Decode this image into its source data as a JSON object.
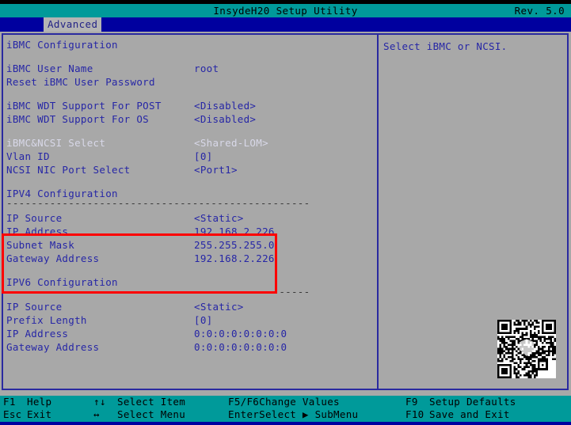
{
  "titlebar": {
    "title": "InsydeH20 Setup Utility",
    "revision": "Rev. 5.0"
  },
  "menubar": {
    "items": [
      {
        "label": "Advanced",
        "selected": true
      }
    ]
  },
  "settings": {
    "rows": [
      {
        "type": "heading",
        "label": "iBMC Configuration",
        "value": ""
      },
      {
        "type": "spacer"
      },
      {
        "type": "item",
        "label": "iBMC User Name",
        "value": "root"
      },
      {
        "type": "item",
        "label": "Reset iBMC User Password",
        "value": ""
      },
      {
        "type": "spacer"
      },
      {
        "type": "item",
        "label": "iBMC WDT Support For POST",
        "value": "<Disabled>"
      },
      {
        "type": "item",
        "label": "iBMC WDT Support For OS",
        "value": "<Disabled>"
      },
      {
        "type": "spacer"
      },
      {
        "type": "item",
        "label": "iBMC&NCSI Select",
        "value": "<Shared-LOM>",
        "selected": true
      },
      {
        "type": "item",
        "label": "Vlan ID",
        "value": "[0]"
      },
      {
        "type": "item",
        "label": "NCSI NIC Port Select",
        "value": "<Port1>"
      },
      {
        "type": "spacer"
      },
      {
        "type": "heading",
        "label": "IPV4 Configuration",
        "value": ""
      },
      {
        "type": "separator",
        "label": "-------------------------------------------------"
      },
      {
        "type": "item",
        "label": "IP Source",
        "value": "<Static>"
      },
      {
        "type": "item",
        "label": "IP Address",
        "value": "192.168.2.226"
      },
      {
        "type": "item",
        "label": "Subnet Mask",
        "value": "255.255.255.0"
      },
      {
        "type": "item",
        "label": "Gateway Address",
        "value": "192.168.2.226"
      },
      {
        "type": "spacer"
      },
      {
        "type": "heading",
        "label": "IPV6 Configuration",
        "value": ""
      },
      {
        "type": "separator",
        "label": "-------------------------------------------------"
      },
      {
        "type": "item",
        "label": "IP Source",
        "value": "<Static>"
      },
      {
        "type": "item",
        "label": "Prefix Length",
        "value": "[0]"
      },
      {
        "type": "item",
        "label": "IP Address",
        "value": "0:0:0:0:0:0:0:0"
      },
      {
        "type": "item",
        "label": "Gateway Address",
        "value": "0:0:0:0:0:0:0:0"
      }
    ]
  },
  "help": {
    "text": "Select iBMC or NCSI."
  },
  "footer": {
    "keys": [
      {
        "key": "F1",
        "action": "Help",
        "col": "col1",
        "row": 0
      },
      {
        "key": "Esc",
        "action": "Exit",
        "col": "col1",
        "row": 1
      },
      {
        "key": "↑↓",
        "action": "Select Item",
        "col": "col2",
        "row": 0
      },
      {
        "key": "↔",
        "action": "Select Menu",
        "col": "col2",
        "row": 1
      },
      {
        "key": "F5/F6",
        "action": "Change Values",
        "col": "col3",
        "row": 0
      },
      {
        "key": "Enter",
        "action": "Select ▶ SubMenu",
        "col": "col3",
        "row": 1
      },
      {
        "key": "F9",
        "action": "Setup Defaults",
        "col": "col4",
        "row": 0
      },
      {
        "key": "F10",
        "action": "Save and Exit",
        "col": "col4",
        "row": 1
      }
    ]
  },
  "annotation": {
    "color": "#ff0000",
    "highlights": [
      "IP Source",
      "IP Address",
      "Subnet Mask",
      "Gateway Address"
    ]
  }
}
